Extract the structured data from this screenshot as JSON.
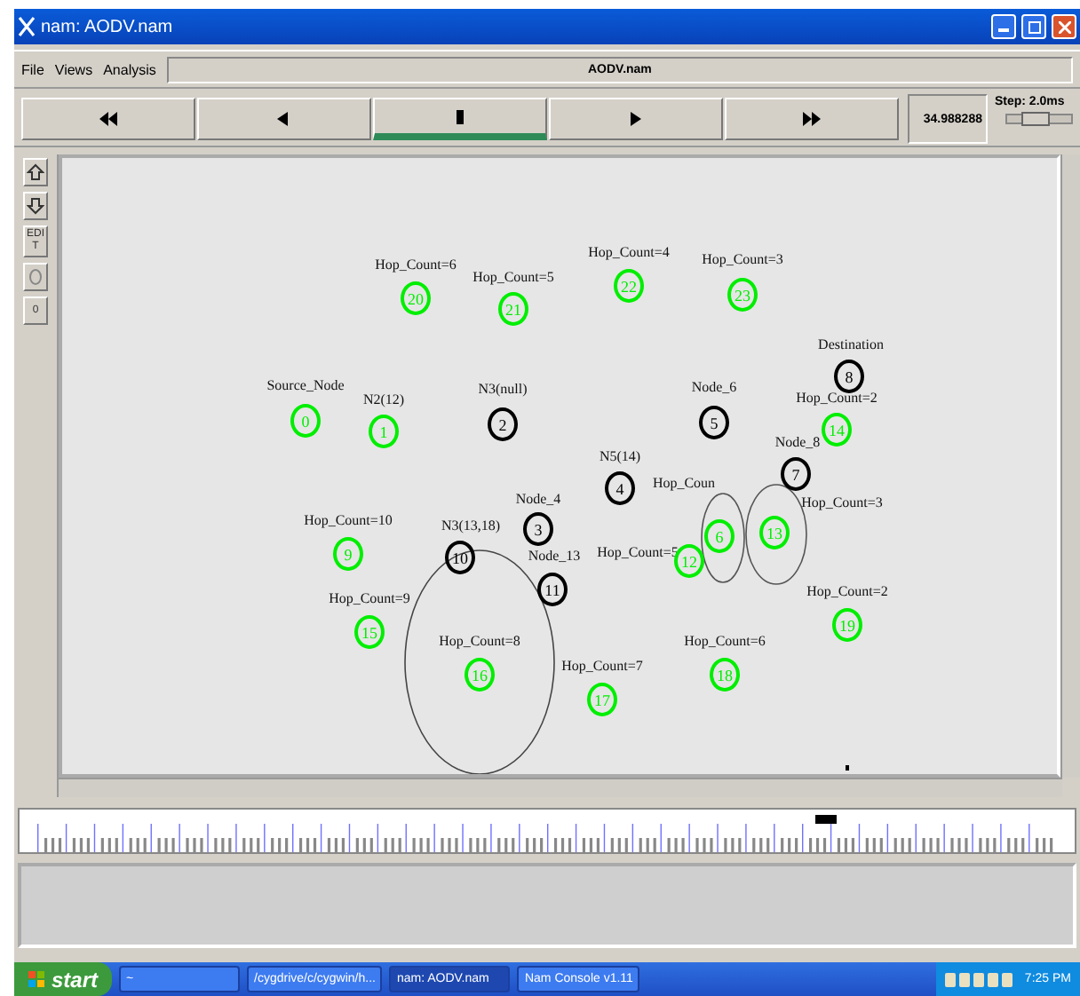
{
  "window": {
    "title": "nam: AODV.nam"
  },
  "menu": [
    {
      "label": "File"
    },
    {
      "label": "Views"
    },
    {
      "label": "Analysis"
    }
  ],
  "file_name": "AODV.nam",
  "playback": [
    {
      "kind": "rewind",
      "selected": false
    },
    {
      "kind": "back",
      "selected": false
    },
    {
      "kind": "stop",
      "selected": true
    },
    {
      "kind": "play",
      "selected": false
    },
    {
      "kind": "forward",
      "selected": false
    }
  ],
  "time": "34.988288",
  "step": {
    "label": "Step: 2.0ms",
    "level": 0.45
  },
  "tools": [
    {
      "kind": "zoom-in"
    },
    {
      "kind": "zoom-out"
    },
    {
      "kind": "edit",
      "label": "EDIT"
    },
    {
      "kind": "circle"
    },
    {
      "kind": "small",
      "label": "0"
    }
  ],
  "nodes": [
    {
      "id": "0",
      "label": "Source_Node",
      "color": "#00ee00"
    },
    {
      "id": "1",
      "label": "N2(12)",
      "color": "#00ee00"
    },
    {
      "id": "2",
      "label": "N3(null)",
      "color": "#000000"
    },
    {
      "id": "3",
      "label": "Node_4",
      "color": "#000000"
    },
    {
      "id": "4",
      "label": "N5(14)",
      "color": "#000000"
    },
    {
      "id": "5",
      "label": "Node_6",
      "color": "#000000"
    },
    {
      "id": "6",
      "label": "Hop_Coun",
      "color": "#00ee00"
    },
    {
      "id": "7",
      "label": "Node_8",
      "color": "#000000"
    },
    {
      "id": "8",
      "label": "Destination",
      "color": "#000000"
    },
    {
      "id": "14",
      "label": "Hop_Count=2",
      "color": "#00ee00"
    },
    {
      "id": "9",
      "label": "Hop_Count=10",
      "color": "#00ee00"
    },
    {
      "id": "10",
      "label": "N3(13,18)",
      "color": "#000000"
    },
    {
      "id": "11",
      "label": "Node_13",
      "color": "#000000"
    },
    {
      "id": "12",
      "label": "Hop_Count=5",
      "color": "#00ee00"
    },
    {
      "id": "13",
      "label": "Hop_Count=3",
      "color": "#00ee00"
    },
    {
      "id": "15",
      "label": "Hop_Count=9",
      "color": "#00ee00"
    },
    {
      "id": "16",
      "label": "Hop_Count=8",
      "color": "#00ee00"
    },
    {
      "id": "17",
      "label": "Hop_Count=7",
      "color": "#00ee00"
    },
    {
      "id": "18",
      "label": "Hop_Count=6",
      "color": "#00ee00"
    },
    {
      "id": "19",
      "label": "Hop_Count=2",
      "color": "#00ee00"
    },
    {
      "id": "20",
      "label": "Hop_Count=6",
      "color": "#00ee00"
    },
    {
      "id": "21",
      "label": "Hop_Count=5",
      "color": "#00ee00"
    },
    {
      "id": "22",
      "label": "Hop_Count=4",
      "color": "#00ee00"
    },
    {
      "id": "23",
      "label": "Hop_Count=3",
      "color": "#00ee00"
    }
  ],
  "taskbar": {
    "start": "start",
    "tasks": [
      {
        "label": "~",
        "selected": false
      },
      {
        "label": "/cygdrive/c/cygwin/h...",
        "selected": false
      },
      {
        "label": "nam: AODV.nam",
        "selected": true
      },
      {
        "label": "Nam Console v1.11",
        "selected": false
      }
    ],
    "clock": "7:25 PM"
  }
}
